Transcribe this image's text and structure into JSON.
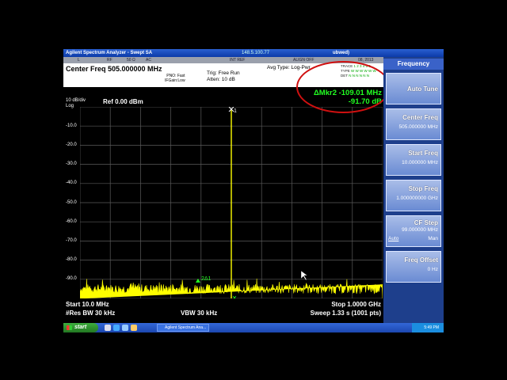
{
  "window": {
    "title": "Agilent Spectrum Analyzer - Swept SA",
    "address": "148.5.100.77",
    "right_title": "ubwed)"
  },
  "status_row": {
    "items": [
      "L",
      "RF",
      "50 Ω",
      "AC",
      "INT REF",
      "ALIGN OFF",
      "08, 2013"
    ]
  },
  "info": {
    "center_freq": "Center Freq 505.000000 MHz",
    "pno": "PNO: Fast",
    "ifgain": "IFGain:Low",
    "trig": "Trig: Free Run",
    "atten": "Atten: 10 dB",
    "avg_type": "Avg Type: Log-Pwr",
    "trace_label": "TRACE",
    "trace_val": "1 2 3 4 5 6",
    "type_label": "TYPE",
    "type_val": "W W W W W W",
    "det_label": "DET",
    "det_val": "N N N N N N"
  },
  "plot": {
    "scale": "10 dB/div",
    "scale_type": "Log",
    "ref": "Ref 0.00 dBm",
    "marker_delta": "ΔMkr2 -109.01 MHz",
    "marker_level": "-91.70 dB",
    "y_labels": [
      "-10.0",
      "-20.0",
      "-30.0",
      "-40.0",
      "-50.0",
      "-60.0",
      "-70.0",
      "-80.0",
      "-90.0"
    ],
    "marker1_label": "1",
    "marker2_label": "2Δ1",
    "start": "Start 10.0 MHz",
    "stop": "Stop 1.0000 GHz",
    "res_bw": "#Res BW 30 kHz",
    "vbw": "VBW 30 kHz",
    "sweep": "Sweep  1.33 s (1001 pts)",
    "colors": {
      "trace": "#ffff00",
      "grid": "#5a5a5a",
      "marker": "#22ff22",
      "highlight": "#d01010"
    }
  },
  "softkeys": {
    "header": "Frequency",
    "keys": [
      {
        "label": "Auto Tune",
        "value": ""
      },
      {
        "label": "Center Freq",
        "value": "505.000000 MHz"
      },
      {
        "label": "Start Freq",
        "value": "10.000000 MHz"
      },
      {
        "label": "Stop Freq",
        "value": "1.000000000 GHz"
      },
      {
        "label": "CF Step",
        "value": "99.000000 MHz",
        "auto": "Auto",
        "man": "Man"
      },
      {
        "label": "Freq Offset",
        "value": "0 Hz"
      }
    ]
  },
  "taskbar": {
    "start": "start",
    "task": "Agilent Spectrum Ana...",
    "clock": "5:49 PM"
  },
  "chart_data": {
    "type": "line",
    "x_range_mhz": [
      10,
      1000
    ],
    "ylim": [
      -100,
      0
    ],
    "noise_floor_dbm": -96,
    "marker1": {
      "x_mhz": 505,
      "y_dbm": 0
    },
    "marker2": {
      "x_mhz": 396,
      "y_dbm": -91.7
    }
  }
}
